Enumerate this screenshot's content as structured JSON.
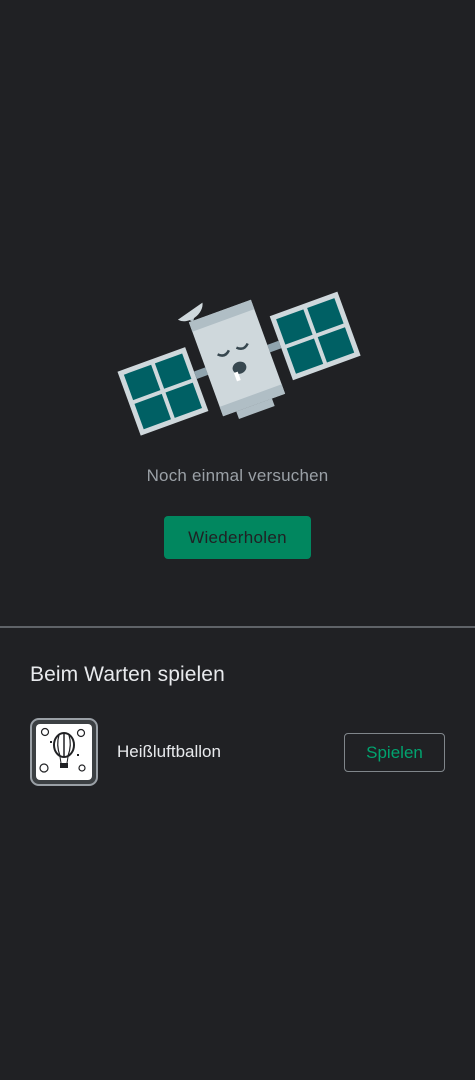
{
  "error": {
    "illustration": "sleeping-satellite-icon",
    "message": "Noch einmal versuchen",
    "retry_label": "Wiederholen"
  },
  "game_section": {
    "title": "Beim Warten spielen",
    "game": {
      "icon": "hot-air-balloon-icon",
      "name": "Heißluftballon",
      "play_label": "Spielen"
    }
  },
  "colors": {
    "background": "#202124",
    "accent": "#01875f",
    "accent_text": "#01a36f",
    "divider": "#5f6368",
    "secondary_text": "#9aa0a6",
    "primary_text": "#e8eaed"
  }
}
